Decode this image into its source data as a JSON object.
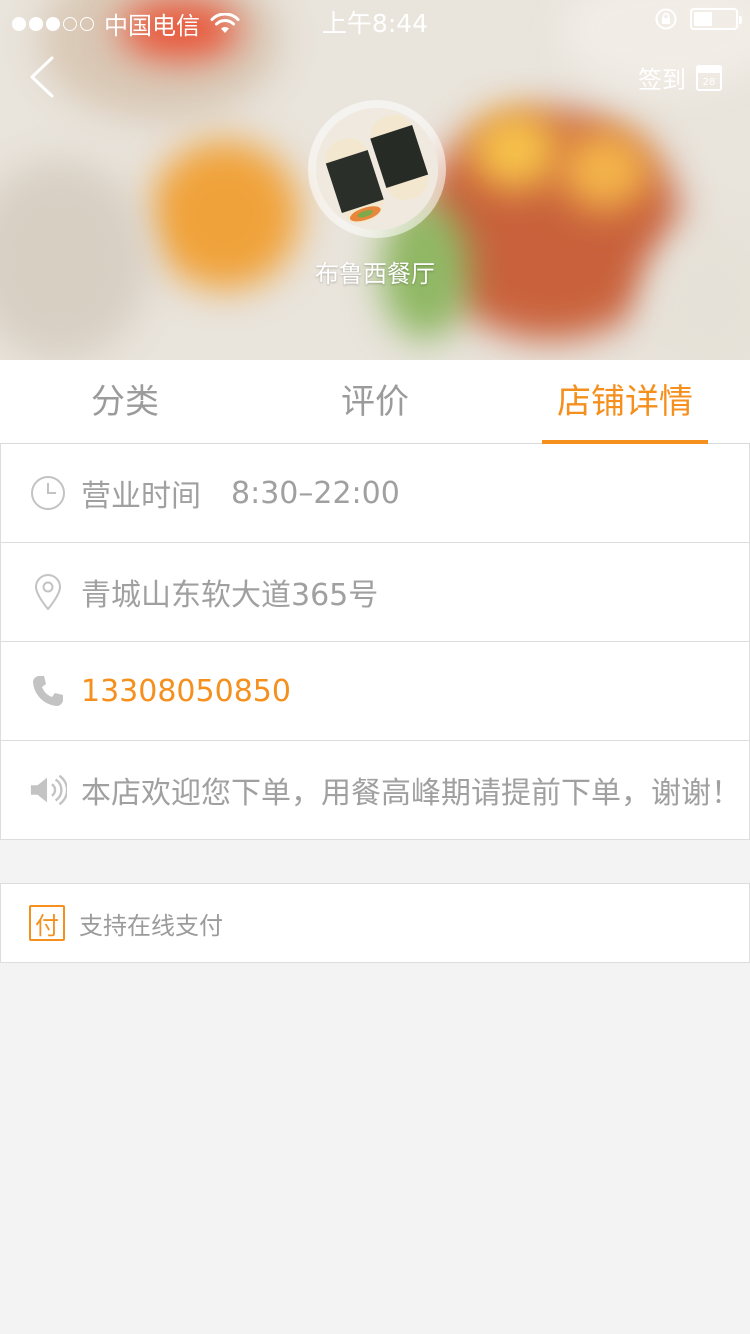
{
  "status_bar": {
    "carrier": "中国电信",
    "time": "上午8:44"
  },
  "header": {
    "checkin_label": "签到",
    "calendar_day": "28",
    "shop_name": "布鲁西餐厅"
  },
  "tabs": [
    {
      "label": "分类",
      "active": false
    },
    {
      "label": "评价",
      "active": false
    },
    {
      "label": "店铺详情",
      "active": true
    }
  ],
  "info": {
    "hours_label": "营业时间",
    "hours_value": "8:30–22:00",
    "address": "青城山东软大道365号",
    "phone": "13308050850",
    "notice": "本店欢迎您下单，用餐高峰期请提前下单，谢谢！"
  },
  "payment": {
    "badge": "付",
    "text": "支持在线支付"
  },
  "colors": {
    "accent": "#f5901e",
    "text_muted": "#9b9b9b",
    "background": "#f3f3f3"
  }
}
